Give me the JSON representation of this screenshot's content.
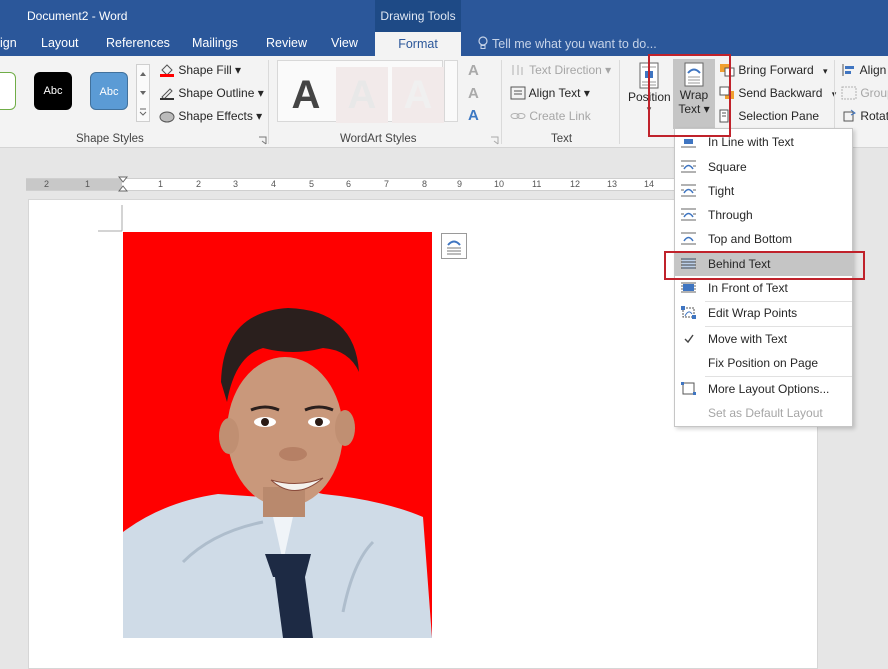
{
  "window": {
    "title": "Document2 - Word",
    "contextual_group": "Drawing Tools"
  },
  "tabs": [
    {
      "label": "ign"
    },
    {
      "label": "Layout"
    },
    {
      "label": "References"
    },
    {
      "label": "Mailings"
    },
    {
      "label": "Review"
    },
    {
      "label": "View"
    },
    {
      "label": "Format"
    }
  ],
  "tell_me": {
    "placeholder": "Tell me what you want to do..."
  },
  "ribbon": {
    "shape_styles": {
      "label": "Shape Styles",
      "swatches": [
        "c",
        "Abc",
        "Abc"
      ],
      "fill": "Shape Fill",
      "outline": "Shape Outline",
      "effects": "Shape Effects"
    },
    "wordart_styles": {
      "label": "WordArt Styles",
      "letters": [
        "A",
        "A",
        "A"
      ],
      "side_letters": [
        "A",
        "A",
        "A"
      ]
    },
    "text": {
      "label": "Text",
      "direction": "Text Direction",
      "align": "Align Text",
      "link": "Create Link"
    },
    "arrange": {
      "position": "Position",
      "wrap_line1": "Wrap",
      "wrap_line2": "Text",
      "bring_forward": "Bring Forward",
      "send_backward": "Send Backward",
      "selection_pane": "Selection Pane",
      "align": "Align",
      "group": "Group",
      "rotate": "Rotat"
    }
  },
  "ruler": {
    "marks": [
      "2",
      "1",
      "1",
      "2",
      "3",
      "4",
      "5",
      "6",
      "7",
      "8",
      "9",
      "10",
      "11",
      "12",
      "13",
      "14"
    ]
  },
  "wrap_menu": {
    "items": [
      {
        "label": "In Line with Text",
        "icon": "inline-wrap-icon",
        "enabled": true
      },
      {
        "label": "Square",
        "icon": "square-wrap-icon",
        "enabled": true
      },
      {
        "label": "Tight",
        "icon": "tight-wrap-icon",
        "enabled": true
      },
      {
        "label": "Through",
        "icon": "through-wrap-icon",
        "enabled": true
      },
      {
        "label": "Top and Bottom",
        "icon": "top-bottom-wrap-icon",
        "enabled": true
      },
      {
        "label": "Behind Text",
        "icon": "behind-text-icon",
        "enabled": true,
        "highlighted": true
      },
      {
        "label": "In Front of Text",
        "icon": "in-front-text-icon",
        "enabled": true
      },
      {
        "label": "Edit Wrap Points",
        "icon": "edit-wrap-points-icon",
        "enabled": true
      },
      {
        "label": "Move with Text",
        "icon": "checkmark-icon",
        "enabled": true,
        "checked": true
      },
      {
        "label": "Fix Position on Page",
        "enabled": true
      },
      {
        "label": "More Layout Options...",
        "icon": "layout-options-icon",
        "enabled": true
      },
      {
        "label": "Set as Default Layout",
        "enabled": false
      }
    ]
  },
  "colors": {
    "title_bar": "#2b579a",
    "photo_background": "#ff0000",
    "highlight_box": "#c0222b"
  }
}
